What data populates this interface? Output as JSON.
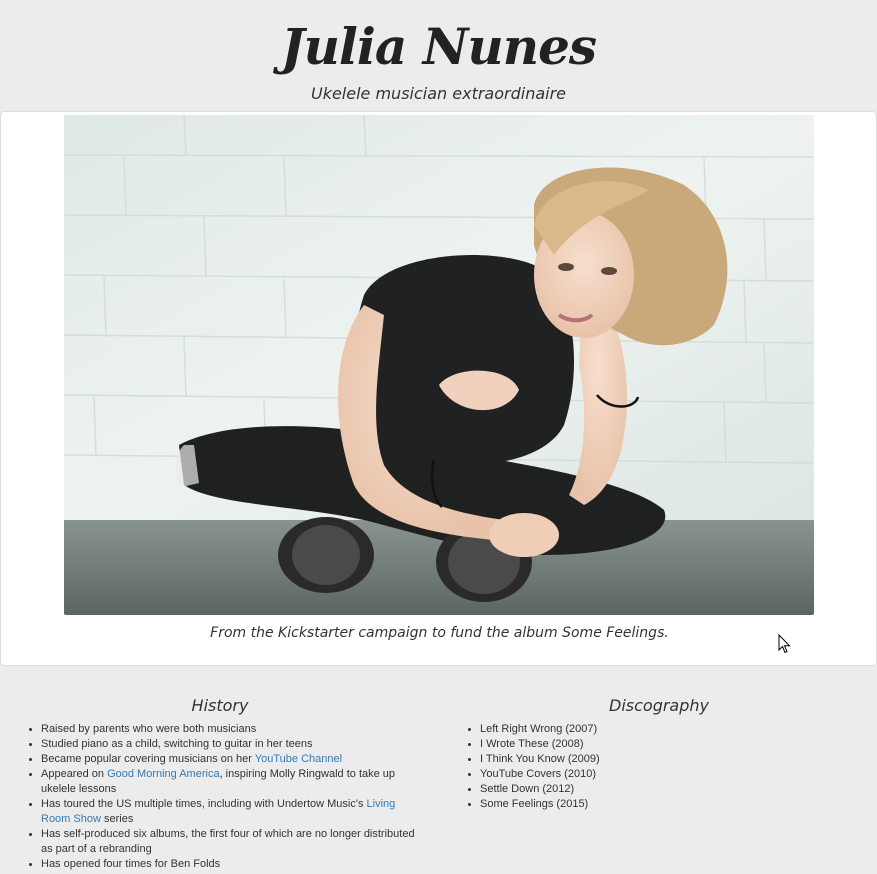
{
  "header": {
    "title": "Julia Nunes",
    "subtitle": "Ukelele musician extraordinaire"
  },
  "figure": {
    "caption": "From the Kickstarter campaign to fund the album Some Feelings."
  },
  "history": {
    "heading": "History",
    "items": [
      {
        "text": "Raised by parents who were both musicians"
      },
      {
        "text": "Studied piano as a child, switching to guitar in her teens"
      },
      {
        "before": "Became popular covering musicians on her ",
        "link": "YouTube Channel",
        "after": ""
      },
      {
        "before": "Appeared on ",
        "link": "Good Morning America",
        "after": ", inspiring Molly Ringwald to take up ukelele lessons"
      },
      {
        "before": "Has toured the US multiple times, including with Undertow Music's ",
        "link": "Living Room Show",
        "after": " series"
      },
      {
        "text": "Has self-produced six albums, the first four of which are no longer distributed as part of a rebranding"
      },
      {
        "text": "Has opened four times for Ben Folds"
      }
    ]
  },
  "discography": {
    "heading": "Discography",
    "items": [
      "Left Right Wrong (2007)",
      "I Wrote These (2008)",
      "I Think You Know (2009)",
      "YouTube Covers (2010)",
      "Settle Down (2012)",
      "Some Feelings (2015)"
    ]
  },
  "colors": {
    "background": "#ececec",
    "link": "#337ab7",
    "panel": "#ffffff"
  }
}
